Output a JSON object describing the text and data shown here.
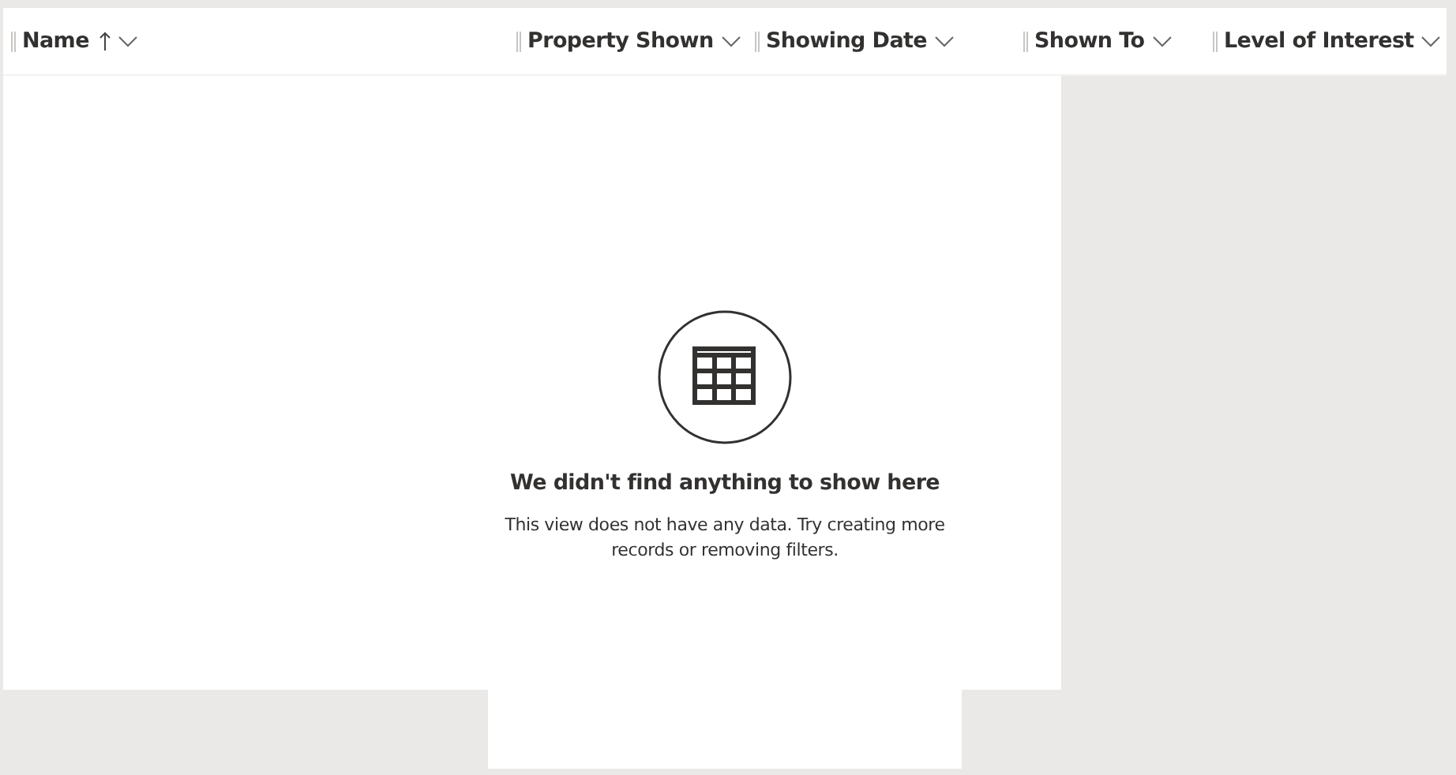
{
  "columns": [
    {
      "label": "Name",
      "sorted": true
    },
    {
      "label": "Property Shown",
      "sorted": false
    },
    {
      "label": "Showing Date",
      "sorted": false
    },
    {
      "label": "Shown To",
      "sorted": false
    },
    {
      "label": "Level of Interest",
      "sorted": false
    }
  ],
  "empty_state": {
    "title": "We didn't find anything to show here",
    "message": "This view does not have any data. Try creating more records or removing filters."
  }
}
